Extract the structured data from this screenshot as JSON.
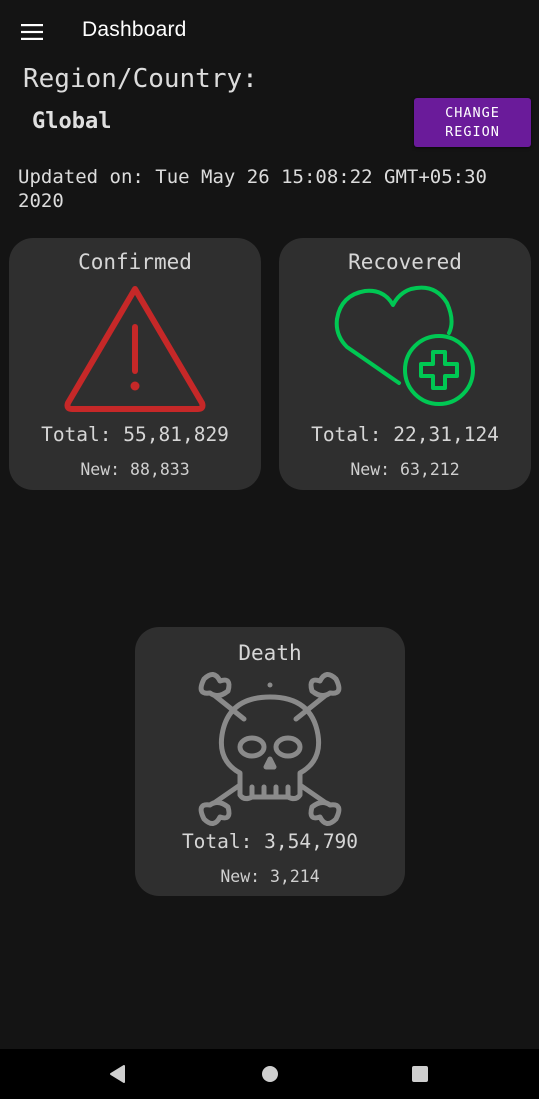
{
  "appbar": {
    "title": "Dashboard",
    "menu_icon": "hamburger-menu-icon"
  },
  "region": {
    "label": "Region/Country:",
    "value": "Global",
    "change_button": {
      "line1": "CHANGE",
      "line2": "REGION"
    }
  },
  "updated": {
    "text": "Updated on: Tue May 26 15:08:22 GMT+05:30 2020"
  },
  "cards": {
    "confirmed": {
      "title": "Confirmed",
      "total": "Total: 55,81,829",
      "new": "New: 88,833",
      "icon": "warning-triangle-icon",
      "color": "#c62828"
    },
    "recovered": {
      "title": "Recovered",
      "total": "Total: 22,31,124",
      "new": "New: 63,212",
      "icon": "heart-plus-icon",
      "color": "#00c853"
    },
    "death": {
      "title": "Death",
      "total": "Total: 3,54,790",
      "new": "New: 3,214",
      "icon": "skull-crossbones-icon",
      "color": "#8a8a8a"
    }
  },
  "colors": {
    "background": "#141414",
    "card": "#2f2f2f",
    "accent": "#6a1b9a"
  },
  "navbar": {
    "back_icon": "back-triangle-icon",
    "home_icon": "home-circle-icon",
    "recents_icon": "recents-square-icon"
  }
}
